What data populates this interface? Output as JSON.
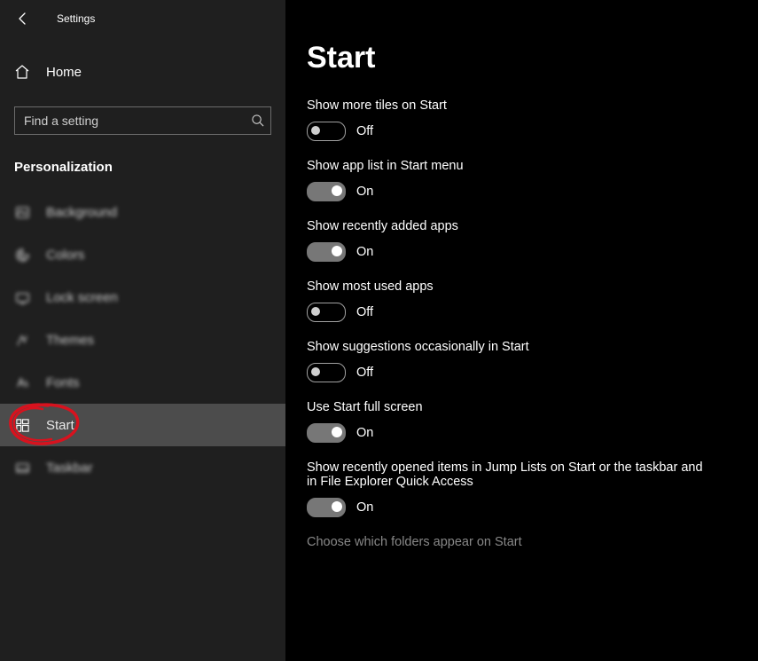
{
  "window": {
    "title": "Settings"
  },
  "sidebar": {
    "home_label": "Home",
    "search_placeholder": "Find a setting",
    "section_header": "Personalization",
    "items": [
      {
        "label": "Background",
        "icon": "background-icon",
        "selected": false,
        "blurry": true
      },
      {
        "label": "Colors",
        "icon": "colors-icon",
        "selected": false,
        "blurry": true
      },
      {
        "label": "Lock screen",
        "icon": "lock-screen-icon",
        "selected": false,
        "blurry": true
      },
      {
        "label": "Themes",
        "icon": "themes-icon",
        "selected": false,
        "blurry": true
      },
      {
        "label": "Fonts",
        "icon": "fonts-icon",
        "selected": false,
        "blurry": true
      },
      {
        "label": "Start",
        "icon": "start-icon",
        "selected": true,
        "blurry": false
      },
      {
        "label": "Taskbar",
        "icon": "taskbar-icon",
        "selected": false,
        "blurry": true
      }
    ]
  },
  "page": {
    "title": "Start",
    "settings": [
      {
        "label": "Show more tiles on Start",
        "on": false,
        "state_text": "Off"
      },
      {
        "label": "Show app list in Start menu",
        "on": true,
        "state_text": "On"
      },
      {
        "label": "Show recently added apps",
        "on": true,
        "state_text": "On"
      },
      {
        "label": "Show most used apps",
        "on": false,
        "state_text": "Off"
      },
      {
        "label": "Show suggestions occasionally in Start",
        "on": false,
        "state_text": "Off"
      },
      {
        "label": "Use Start full screen",
        "on": true,
        "state_text": "On"
      },
      {
        "label": "Show recently opened items in Jump Lists on Start or the taskbar and in File Explorer Quick Access",
        "on": true,
        "state_text": "On"
      }
    ],
    "link_text": "Choose which folders appear on Start"
  },
  "annotation": {
    "highlight_index": 5,
    "color": "#d8121e"
  }
}
